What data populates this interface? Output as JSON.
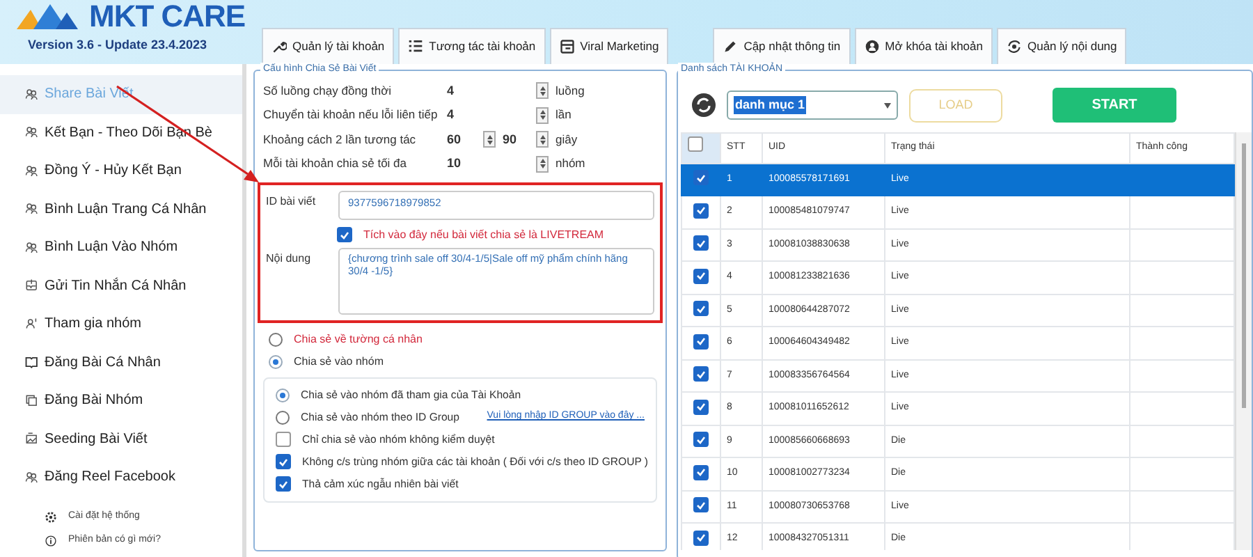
{
  "app": {
    "title": "MKT CARE",
    "version": "Version 3.6 - Update 23.4.2023"
  },
  "tabs": [
    {
      "label": "Quản lý tài khoản"
    },
    {
      "label": "Tương tác tài khoản"
    },
    {
      "label": "Viral Marketing"
    },
    {
      "label": "Cập nhật thông tin"
    },
    {
      "label": "Mở khóa tài khoản"
    },
    {
      "label": "Quản lý nội dung"
    }
  ],
  "sidebar": {
    "items": [
      {
        "label": "Share Bài Viết",
        "selected": true
      },
      {
        "label": "Kết Bạn - Theo Dõi Bạn Bè",
        "selected": false
      },
      {
        "label": "Đồng Ý - Hủy Kết Bạn",
        "selected": false
      },
      {
        "label": "Bình Luận Trang Cá Nhân",
        "selected": false
      },
      {
        "label": "Bình Luận Vào Nhóm",
        "selected": false
      },
      {
        "label": "Gửi Tin Nhắn Cá Nhân",
        "selected": false
      },
      {
        "label": "Tham gia nhóm",
        "selected": false
      },
      {
        "label": "Đăng Bài Cá Nhân",
        "selected": false
      },
      {
        "label": "Đăng Bài Nhóm",
        "selected": false
      },
      {
        "label": "Seeding Bài Viết",
        "selected": false
      },
      {
        "label": "Đăng Reel Facebook",
        "selected": false
      }
    ],
    "footer_items": [
      {
        "label": "Cài đặt hệ thống"
      },
      {
        "label": "Phiên bản có gì mới?"
      }
    ]
  },
  "share_config": {
    "legend": "Cấu hình Chia Sẻ Bài Viết",
    "settings": [
      {
        "label": "Số luồng chạy đồng thời",
        "values": [
          "4"
        ],
        "unit": "luồng"
      },
      {
        "label": "Chuyển tài khoản nếu lỗi liên tiếp",
        "values": [
          "4"
        ],
        "unit": "lần"
      },
      {
        "label": "Khoảng cách 2 lần tương tác",
        "values": [
          "60",
          "90"
        ],
        "unit": "giây"
      },
      {
        "label": "Mỗi tài khoản chia sẻ tối đa",
        "values": [
          "10"
        ],
        "unit": "nhóm"
      }
    ],
    "post_id": {
      "label": "ID bài viết",
      "value": "9377596718979852"
    },
    "livestream": {
      "label": "Tích vào đây nếu bài viết chia sẻ là LIVETREAM",
      "checked": true
    },
    "content": {
      "label": "Nội dung",
      "value": "{chương trình sale off 30/4-1/5|Sale off mỹ phẩm chính hãng 30/4 -1/5}"
    },
    "targets": [
      {
        "label": "Chia sẻ về tường cá nhân",
        "selected": false,
        "emphasis": true
      },
      {
        "label": "Chia sẻ vào nhóm",
        "selected": true,
        "emphasis": false
      }
    ],
    "group_options": [
      {
        "kind": "radio",
        "label": "Chia sẻ vào nhóm đã tham gia của Tài Khoản",
        "selected": true
      },
      {
        "kind": "radio",
        "label": "Chia sẻ vào nhóm theo ID Group",
        "selected": false,
        "link": "Vui lòng nhập ID GROUP vào đây ..."
      },
      {
        "kind": "checkbox",
        "label": "Chỉ chia sẻ vào nhóm không kiểm duyệt",
        "checked": false
      },
      {
        "kind": "checkbox",
        "label": "Không c/s trùng nhóm giữa các tài khoản ( Đối với c/s theo ID GROUP )",
        "checked": true
      },
      {
        "kind": "checkbox",
        "label": "Thả cảm xúc ngẫu nhiên bài viết",
        "checked": true
      }
    ]
  },
  "accounts": {
    "legend": "Danh sách TÀI KHOẢN",
    "category": "danh mục 1",
    "load": "LOAD",
    "start": "START",
    "all_checked": false,
    "columns": [
      "STT",
      "UID",
      "Trạng thái",
      "Thành công"
    ],
    "rows": [
      {
        "stt": "1",
        "uid": "100085578171691",
        "status": "Live",
        "checked": true,
        "selected": true
      },
      {
        "stt": "2",
        "uid": "100085481079747",
        "status": "Live",
        "checked": true,
        "selected": false
      },
      {
        "stt": "3",
        "uid": "100081038830638",
        "status": "Live",
        "checked": true,
        "selected": false
      },
      {
        "stt": "4",
        "uid": "100081233821636",
        "status": "Live",
        "checked": true,
        "selected": false
      },
      {
        "stt": "5",
        "uid": "100080644287072",
        "status": "Live",
        "checked": true,
        "selected": false
      },
      {
        "stt": "6",
        "uid": "100064604349482",
        "status": "Live",
        "checked": true,
        "selected": false
      },
      {
        "stt": "7",
        "uid": "100083356764564",
        "status": "Live",
        "checked": true,
        "selected": false
      },
      {
        "stt": "8",
        "uid": "100081011652612",
        "status": "Live",
        "checked": true,
        "selected": false
      },
      {
        "stt": "9",
        "uid": "100085660668693",
        "status": "Die",
        "checked": true,
        "selected": false
      },
      {
        "stt": "10",
        "uid": "100081002773234",
        "status": "Die",
        "checked": true,
        "selected": false
      },
      {
        "stt": "11",
        "uid": "100080730653768",
        "status": "Live",
        "checked": true,
        "selected": false
      },
      {
        "stt": "12",
        "uid": "100084327051311",
        "status": "Die",
        "checked": true,
        "selected": false
      }
    ]
  }
}
